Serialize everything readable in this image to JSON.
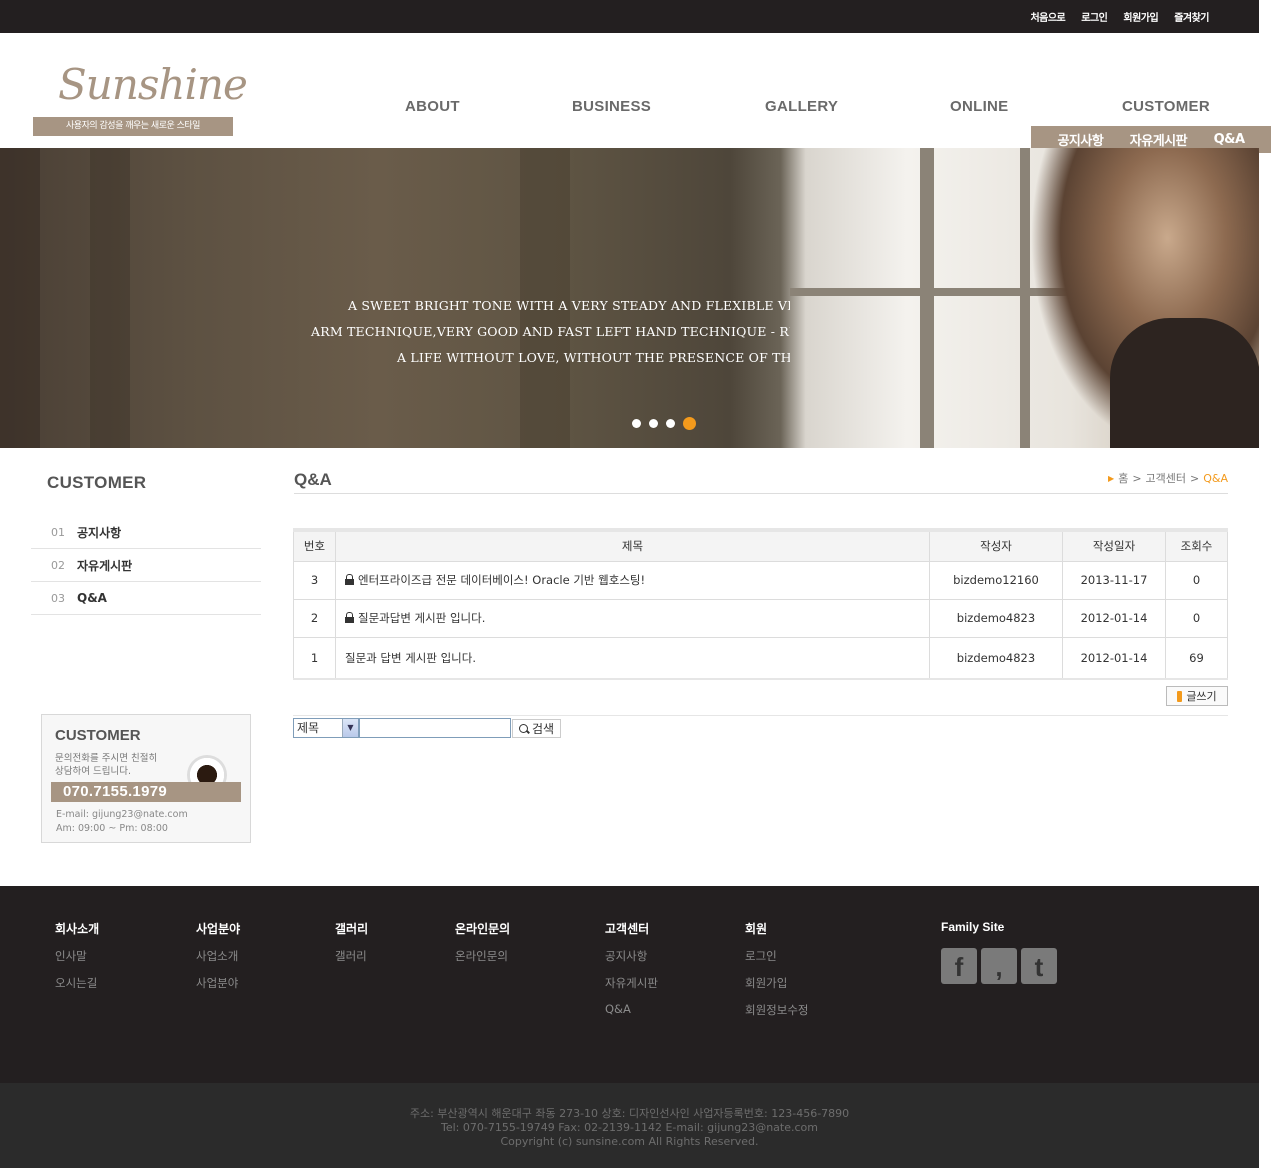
{
  "top_links": [
    "처음으로",
    "로그인",
    "회원가입",
    "즐겨찾기"
  ],
  "logo": {
    "text": "Sunshine",
    "tagline": "사용자의 감성을 깨우는 새로운 스타일"
  },
  "gnb": [
    "ABOUT",
    "BUSINESS",
    "GALLERY",
    "ONLINE",
    "CUSTOMER"
  ],
  "subnav": [
    "공지사항",
    "자유게시판",
    "Q&A"
  ],
  "banner": {
    "lines": [
      "A SWEET BRIGHT TONE WITH A VERY STEADY AND FLEXIBLE VIBRATO,",
      "ARM TECHNIQUE,VERY GOOD AND FAST LEFT HAND TECHNIQUE - RUDOLF K",
      "A LIFE WITHOUT LOVE, WITHOUT THE PRESENCE OF THE BELO"
    ],
    "slides": 4,
    "active_slide": 4
  },
  "sidebar": {
    "title": "CUSTOMER",
    "items": [
      {
        "num": "01",
        "label": "공지사항"
      },
      {
        "num": "02",
        "label": "자유게시판"
      },
      {
        "num": "03",
        "label": "Q&A"
      }
    ],
    "cs": {
      "title": "CUSTOMER",
      "desc": "문의전화를 주시면 친절히\n상담하여 드립니다.",
      "phone": "070.7155.1979",
      "email": "E-mail: gijung23@nate.com",
      "hours": "Am: 09:00 ~ Pm: 08:00"
    }
  },
  "page": {
    "title": "Q&A",
    "breadcrumb": [
      "홈",
      "고객센터",
      "Q&A"
    ]
  },
  "board": {
    "headers": [
      "번호",
      "제목",
      "작성자",
      "작성일자",
      "조회수"
    ],
    "rows": [
      {
        "num": "3",
        "subject": "엔터프라이즈급 전문 데이터베이스! Oracle 기반 웹호스팅!",
        "locked": true,
        "writer": "bizdemo12160",
        "date": "2013-11-17",
        "views": "0"
      },
      {
        "num": "2",
        "subject": "질문과답변 게시판 입니다.",
        "locked": true,
        "writer": "bizdemo4823",
        "date": "2012-01-14",
        "views": "0"
      },
      {
        "num": "1",
        "subject": "질문과 답변 게시판 입니다.",
        "locked": false,
        "writer": "bizdemo4823",
        "date": "2012-01-14",
        "views": "69"
      }
    ],
    "write_label": "글쓰기",
    "search": {
      "field": "제목",
      "value": "",
      "button": "검색"
    }
  },
  "footer": {
    "columns": [
      {
        "title": "회사소개",
        "links": [
          "인사말",
          "오시는길"
        ]
      },
      {
        "title": "사업분야",
        "links": [
          "사업소개",
          "사업분야"
        ]
      },
      {
        "title": "갤러리",
        "links": [
          "갤러리"
        ]
      },
      {
        "title": "온라인문의",
        "links": [
          "온라인문의"
        ]
      },
      {
        "title": "고객센터",
        "links": [
          "공지사항",
          "자유게시판",
          "Q&A"
        ]
      },
      {
        "title": "회원",
        "links": [
          "로그인",
          "회원가입",
          "회원정보수정"
        ]
      }
    ],
    "family_title": "Family Site",
    "sns": [
      "facebook-icon",
      "blog-icon",
      "twitter-icon"
    ],
    "copy": [
      "주소: 부산광역시 해운대구 좌동 273-10  상호: 디자인선사인  사업자등록번호: 123-456-7890",
      "Tel: 070-7155-19749  Fax: 02-2139-1142  E-mail: gijung23@nate.com",
      "Copyright (c) sunsine.com All Rights Reserved."
    ]
  }
}
